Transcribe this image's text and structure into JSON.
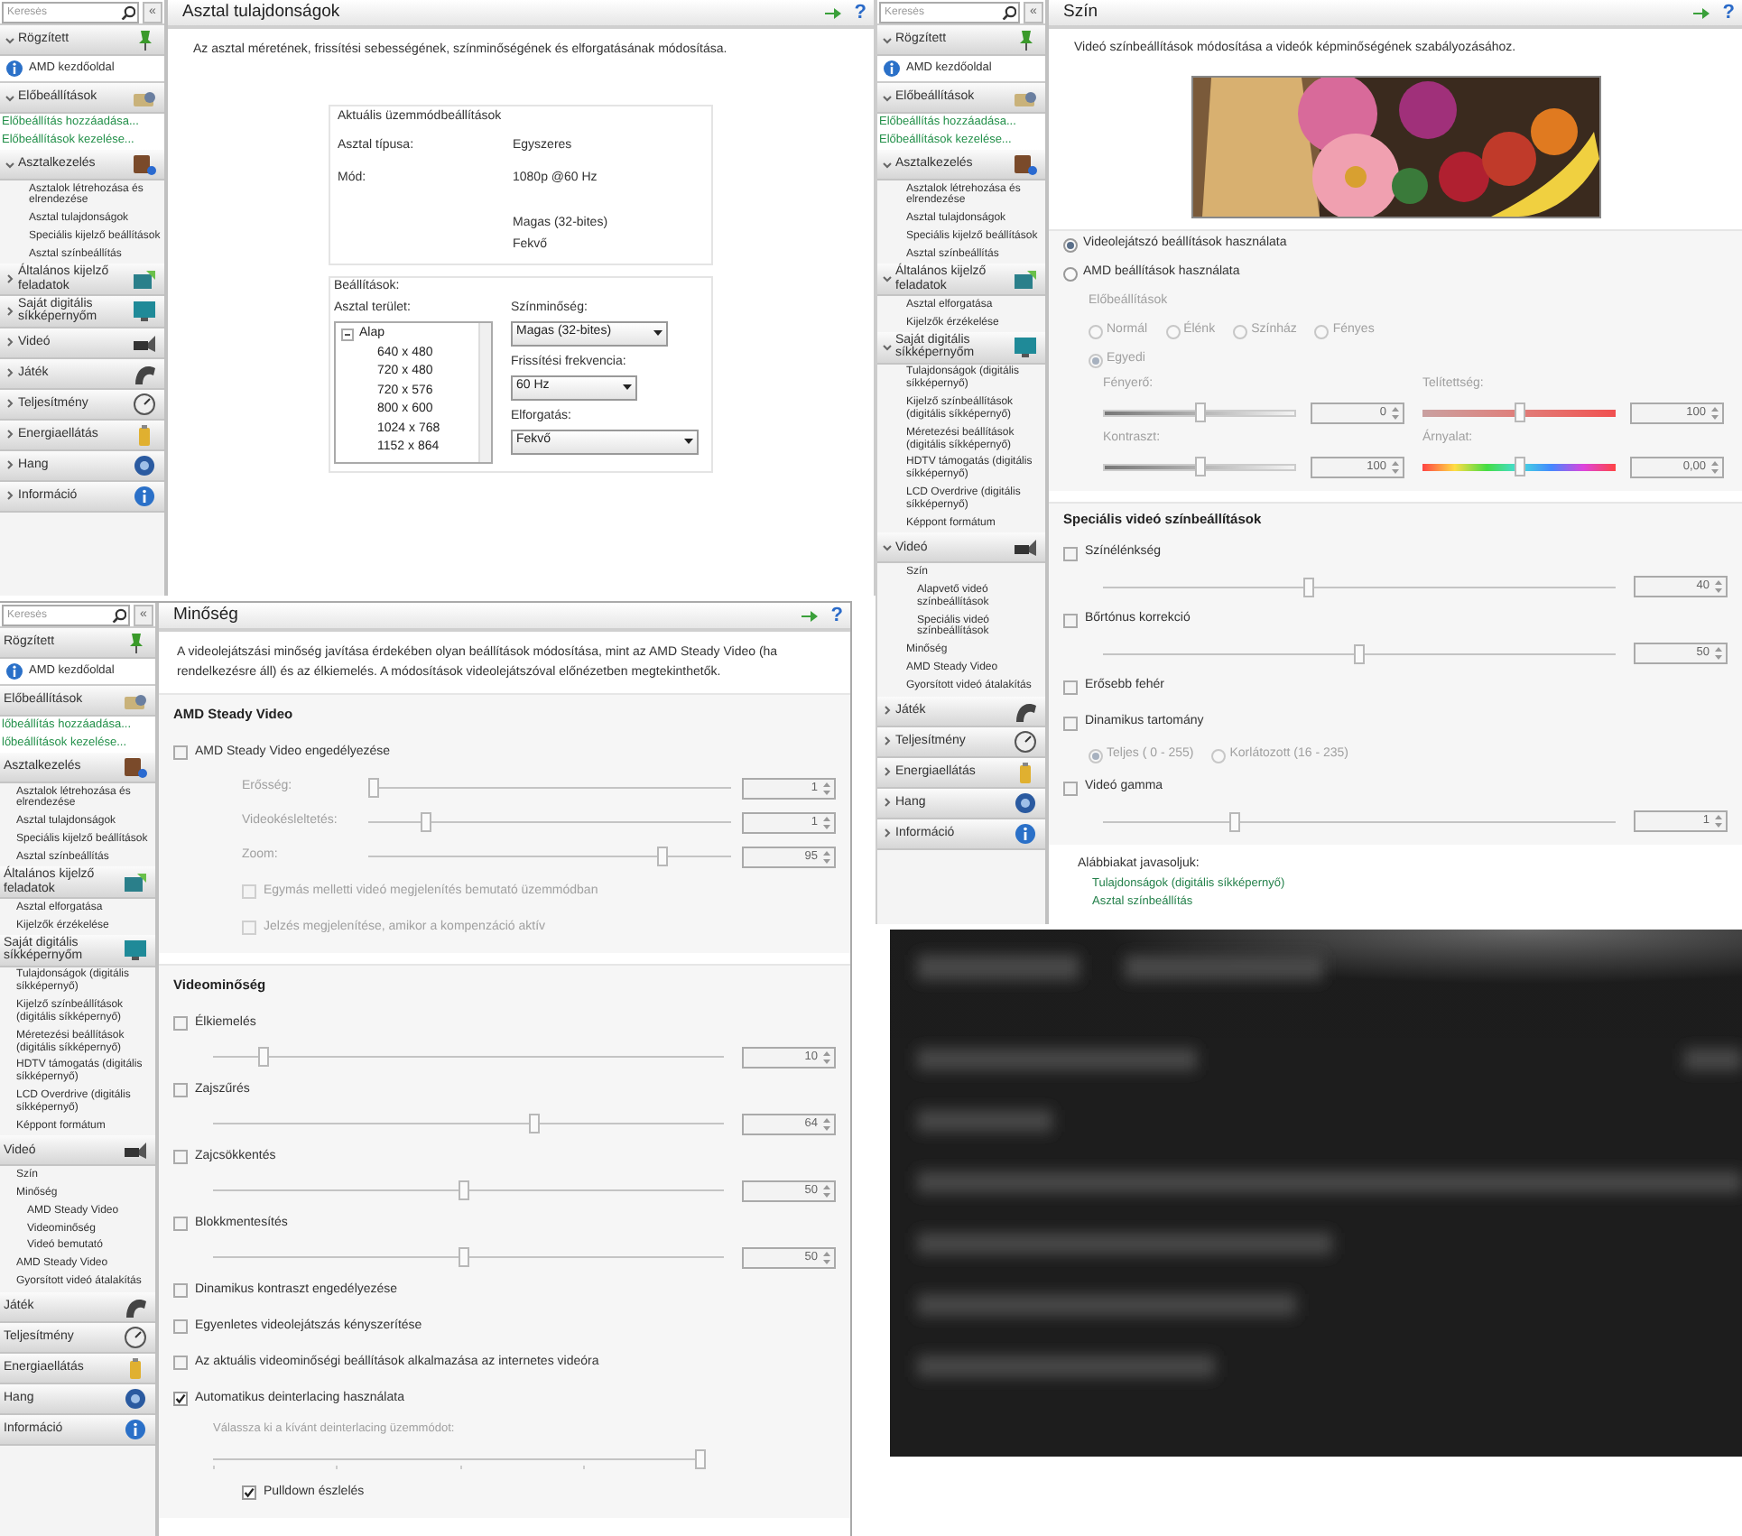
{
  "windows": [
    {
      "kind": "desktop",
      "sidebar": {
        "search_placeholder": "Keresés",
        "collapse": "«",
        "items": [
          {
            "kind": "header",
            "label": "Rögzített",
            "expanded": true
          },
          {
            "kind": "home",
            "label": "AMD kezdőoldal"
          },
          {
            "kind": "header",
            "label": "Előbeállítások",
            "expanded": true
          },
          {
            "kind": "link",
            "label": "Előbeállítás hozzáadása..."
          },
          {
            "kind": "link",
            "label": "Előbeállítások kezelése..."
          },
          {
            "kind": "header",
            "label": "Asztalkezelés",
            "expanded": true
          },
          {
            "kind": "sub",
            "label": "Asztalok létrehozása és elrendezése"
          },
          {
            "kind": "sub",
            "label": "Asztal tulajdonságok"
          },
          {
            "kind": "sub",
            "label": "Speciális kijelző beállítások"
          },
          {
            "kind": "sub",
            "label": "Asztal színbeállítás"
          },
          {
            "kind": "header",
            "label": "Általános kijelző feladatok",
            "expanded": false
          },
          {
            "kind": "header",
            "label": "Saját digitális síkképernyőm",
            "expanded": false
          },
          {
            "kind": "header",
            "label": "Videó",
            "expanded": false
          },
          {
            "kind": "header",
            "label": "Játék",
            "expanded": false
          },
          {
            "kind": "header",
            "label": "Teljesítmény",
            "expanded": false
          },
          {
            "kind": "header",
            "label": "Energiaellátás",
            "expanded": false
          },
          {
            "kind": "header",
            "label": "Hang",
            "expanded": false
          },
          {
            "kind": "header",
            "label": "Információ",
            "expanded": false
          }
        ]
      },
      "title": "Asztal tulajdonságok",
      "help": "?",
      "description": "Az asztal méretének, frissítési sebességének, színminőségének és elforgatásának módosítása.",
      "current_mode": {
        "title": "Aktuális üzemmódbeállítások",
        "rows": [
          {
            "label": "Asztal típusa:",
            "value": "Egyszeres"
          },
          {
            "label": "Mód:",
            "value": "1080p @60 Hz"
          },
          {
            "value": "Magas (32-bites)"
          },
          {
            "value": "Fekvő"
          }
        ]
      },
      "settings": {
        "title": "Beállítások:",
        "area_label": "Asztal terület:",
        "tree": {
          "label": "Alap",
          "expanded": true,
          "items": [
            "640 x 480",
            "720 x 480",
            "720 x 576",
            "800 x 600",
            "1024 x 768",
            "1152 x 864"
          ]
        },
        "fields": [
          {
            "label": "Színminőség:",
            "value": "Magas (32-bites)"
          },
          {
            "label": "Frissítési frekvencia:",
            "value": "60 Hz"
          },
          {
            "label": "Elforgatás:",
            "value": "Fekvő"
          }
        ]
      }
    },
    {
      "kind": "color",
      "sidebar": {
        "search_placeholder": "Keresés",
        "collapse": "«",
        "items": [
          {
            "kind": "header",
            "label": "Rögzített",
            "expanded": true
          },
          {
            "kind": "home",
            "label": "AMD kezdőoldal"
          },
          {
            "kind": "header",
            "label": "Előbeállítások",
            "expanded": true
          },
          {
            "kind": "link",
            "label": "Előbeállítás hozzáadása..."
          },
          {
            "kind": "link",
            "label": "Előbeállítások kezelése..."
          },
          {
            "kind": "header",
            "label": "Asztalkezelés",
            "expanded": true
          },
          {
            "kind": "sub",
            "label": "Asztalok létrehozása és elrendezése"
          },
          {
            "kind": "sub",
            "label": "Asztal tulajdonságok"
          },
          {
            "kind": "sub",
            "label": "Speciális kijelző beállítások"
          },
          {
            "kind": "sub",
            "label": "Asztal színbeállítás"
          },
          {
            "kind": "header",
            "label": "Általános kijelző feladatok",
            "expanded": true
          },
          {
            "kind": "sub",
            "label": "Asztal elforgatása"
          },
          {
            "kind": "sub",
            "label": "Kijelzők érzékelése"
          },
          {
            "kind": "header",
            "label": "Saját digitális síkképernyőm",
            "expanded": true
          },
          {
            "kind": "sub",
            "label": "Tulajdonságok (digitális síkképernyő)"
          },
          {
            "kind": "sub",
            "label": "Kijelző színbeállítások (digitális síkképernyő)"
          },
          {
            "kind": "sub",
            "label": "Méretezési beállítások (digitális síkképernyő)"
          },
          {
            "kind": "sub",
            "label": "HDTV támogatás (digitális síkképernyő)"
          },
          {
            "kind": "sub",
            "label": "LCD Overdrive (digitális síkképernyő)"
          },
          {
            "kind": "sub",
            "label": "Képpont formátum"
          },
          {
            "kind": "header",
            "label": "Videó",
            "expanded": true
          },
          {
            "kind": "sub",
            "label": "Szín"
          },
          {
            "kind": "sub2",
            "label": "Alapvető videó színbeállítások"
          },
          {
            "kind": "sub2",
            "label": "Speciális videó színbeállítások"
          },
          {
            "kind": "sub",
            "label": "Minőség"
          },
          {
            "kind": "sub",
            "label": "AMD Steady Video"
          },
          {
            "kind": "sub",
            "label": "Gyorsított videó átalakítás"
          },
          {
            "kind": "header",
            "label": "Játék",
            "expanded": false
          },
          {
            "kind": "header",
            "label": "Teljesítmény",
            "expanded": false
          },
          {
            "kind": "header",
            "label": "Energiaellátás",
            "expanded": false
          },
          {
            "kind": "header",
            "label": "Hang",
            "expanded": false
          },
          {
            "kind": "header",
            "label": "Információ",
            "expanded": false
          }
        ]
      },
      "title": "Szín",
      "help": "?",
      "description": "Videó színbeállítások módosítása a videók képminőségének szabályozásához.",
      "image": {
        "kind": "picture"
      },
      "sections": [
        {
          "rows": [
            {
              "kind": "radio",
              "label": "Videolejátszó beállítások használata",
              "selected": true,
              "disabled": false
            },
            {
              "kind": "radio",
              "label": "AMD beállítások használata",
              "selected": false,
              "disabled": false
            },
            {
              "kind": "label",
              "text": "Előbeállítások",
              "disabled": true
            },
            {
              "kind": "radio_inline",
              "disabled": true,
              "options": [
                {
                  "label": "Normál",
                  "selected": false
                },
                {
                  "label": "Élénk",
                  "selected": false
                },
                {
                  "label": "Színház",
                  "selected": false
                },
                {
                  "label": "Fényes",
                  "selected": false
                }
              ]
            },
            {
              "kind": "radio_inline",
              "disabled": true,
              "options": [
                {
                  "label": "Egyedi",
                  "selected": true
                }
              ]
            },
            {
              "kind": "slider_pair",
              "items": [
                {
                  "label": "Fényerő:",
                  "value": "0",
                  "level": 0.5,
                  "kind": "gray",
                  "disabled": true
                },
                {
                  "label": "Telítettség:",
                  "value": "100",
                  "level": 0.5,
                  "kind": "red",
                  "disabled": true
                }
              ]
            },
            {
              "kind": "slider_pair",
              "items": [
                {
                  "label": "Kontraszt:",
                  "value": "100",
                  "level": 0.5,
                  "kind": "gray",
                  "disabled": true
                },
                {
                  "label": "Árnyalat:",
                  "value": "0,00",
                  "level": 0.5,
                  "kind": "rainbow",
                  "disabled": true
                }
              ]
            }
          ]
        },
        {
          "heading": "Speciális videó színbeállítások",
          "rows": [
            {
              "kind": "checkbox",
              "label": "Színélénkség",
              "checked": false,
              "disabled": false
            },
            {
              "kind": "slider",
              "value": "40",
              "level": 0.4,
              "disabled": true
            },
            {
              "kind": "checkbox",
              "label": "Bőrtónus korrekció",
              "checked": false,
              "disabled": false
            },
            {
              "kind": "slider",
              "value": "50",
              "level": 0.5,
              "disabled": true
            },
            {
              "kind": "checkbox",
              "label": "Erősebb fehér",
              "checked": false,
              "disabled": false
            },
            {
              "kind": "checkbox",
              "label": "Dinamikus tartomány",
              "checked": false,
              "disabled": false
            },
            {
              "kind": "radio_inline",
              "disabled": true,
              "options": [
                {
                  "label": "Teljes ( 0 - 255)",
                  "selected": true
                },
                {
                  "label": "Korlátozott (16 - 235)",
                  "selected": false
                }
              ]
            },
            {
              "kind": "checkbox",
              "label": "Videó gamma",
              "checked": false,
              "disabled": false
            },
            {
              "kind": "slider",
              "value": "1",
              "level": 0.25,
              "disabled": true
            }
          ]
        }
      ],
      "suggestions": {
        "title": "Alábbiakat javasoljuk:",
        "links": [
          "Tulajdonságok (digitális síkképernyő)",
          "Asztal színbeállítás"
        ]
      }
    },
    {
      "kind": "quality",
      "sidebar": {
        "search_placeholder": "Keresés",
        "collapse": "«",
        "items": [
          {
            "kind": "header",
            "label": "Rögzített"
          },
          {
            "kind": "home",
            "label": "AMD kezdőoldal"
          },
          {
            "kind": "header",
            "label": "Előbeállítások"
          },
          {
            "kind": "link",
            "label": "lőbeállítás hozzáadása..."
          },
          {
            "kind": "link",
            "label": "lőbeállítások kezelése..."
          },
          {
            "kind": "header",
            "label": "Asztalkezelés"
          },
          {
            "kind": "sub",
            "label": "Asztalok létrehozása és elrendezése"
          },
          {
            "kind": "sub",
            "label": "Asztal tulajdonságok"
          },
          {
            "kind": "sub",
            "label": "Speciális kijelző beállítások"
          },
          {
            "kind": "sub",
            "label": "Asztal színbeállítás"
          },
          {
            "kind": "header",
            "label": "Általános kijelző feladatok"
          },
          {
            "kind": "sub",
            "label": "Asztal elforgatása"
          },
          {
            "kind": "sub",
            "label": "Kijelzők érzékelése"
          },
          {
            "kind": "header",
            "label": "Saját digitális síkképernyőm"
          },
          {
            "kind": "sub",
            "label": "Tulajdonságok (digitális síkképernyő)"
          },
          {
            "kind": "sub",
            "label": "Kijelző színbeállítások (digitális síkképernyő)"
          },
          {
            "kind": "sub",
            "label": "Méretezési beállítások (digitális síkképernyő)"
          },
          {
            "kind": "sub",
            "label": "HDTV támogatás (digitális síkképernyő)"
          },
          {
            "kind": "sub",
            "label": "LCD Overdrive (digitális síkképernyő)"
          },
          {
            "kind": "sub",
            "label": "Képpont formátum"
          },
          {
            "kind": "header",
            "label": "Videó"
          },
          {
            "kind": "sub",
            "label": "Szín"
          },
          {
            "kind": "sub",
            "label": "Minőség"
          },
          {
            "kind": "sub2",
            "label": "AMD Steady Video"
          },
          {
            "kind": "sub2",
            "label": "Videominőség"
          },
          {
            "kind": "sub2",
            "label": "Videó bemutató"
          },
          {
            "kind": "sub",
            "label": "AMD Steady Video"
          },
          {
            "kind": "sub",
            "label": "Gyorsított videó átalakítás"
          },
          {
            "kind": "header",
            "label": "Játék"
          },
          {
            "kind": "header",
            "label": "Teljesítmény"
          },
          {
            "kind": "header",
            "label": "Energiaellátás"
          },
          {
            "kind": "header",
            "label": "Hang"
          },
          {
            "kind": "header",
            "label": "Információ"
          }
        ]
      },
      "title": "Minőség",
      "help": "?",
      "description": "A videolejátszási minőség javítása érdekében olyan beállítások módosítása, mint az AMD Steady Video (ha rendelkezésre áll) és az élkiemelés. A módosítások videolejátszóval előnézetben megtekinthetők.",
      "sections": [
        {
          "heading": "AMD Steady Video",
          "rows": [
            {
              "kind": "checkbox",
              "label": "AMD Steady Video engedélyezése",
              "checked": false,
              "disabled": false
            },
            {
              "kind": "slider",
              "label": "Erősség:",
              "value": "1",
              "level": 0.0,
              "disabled": true
            },
            {
              "kind": "slider",
              "label": "Videokésleltetés:",
              "value": "1",
              "level": 0.15,
              "disabled": true
            },
            {
              "kind": "slider",
              "label": "Zoom:",
              "value": "95",
              "level": 0.82,
              "disabled": true
            },
            {
              "kind": "subcheckbox",
              "label": "Egymás melletti videó megjelenítés bemutató üzemmódban",
              "checked": false,
              "disabled": true
            },
            {
              "kind": "subcheckbox",
              "label": "Jelzés megjelenítése, amikor a kompenzáció aktív",
              "checked": false,
              "disabled": true
            }
          ]
        },
        {
          "heading": "Videominőség",
          "rows": [
            {
              "kind": "checkbox",
              "label": "Élkiemelés",
              "checked": false,
              "disabled": false
            },
            {
              "kind": "slider",
              "value": "10",
              "level": 0.09,
              "disabled": true
            },
            {
              "kind": "checkbox",
              "label": "Zajszűrés",
              "checked": false,
              "disabled": false
            },
            {
              "kind": "slider",
              "value": "64",
              "level": 0.63,
              "disabled": true
            },
            {
              "kind": "checkbox",
              "label": "Zajcsökkentés",
              "checked": false,
              "disabled": false
            },
            {
              "kind": "slider",
              "value": "50",
              "level": 0.49,
              "disabled": true
            },
            {
              "kind": "checkbox",
              "label": "Blokkmentesítés",
              "checked": false,
              "disabled": false
            },
            {
              "kind": "slider",
              "value": "50",
              "level": 0.49,
              "disabled": true
            },
            {
              "kind": "checkbox",
              "label": "Dinamikus kontraszt engedélyezése",
              "checked": false,
              "disabled": false
            },
            {
              "kind": "checkbox",
              "label": "Egyenletes videolejátszás kényszerítése",
              "checked": false,
              "disabled": false
            },
            {
              "kind": "checkbox",
              "label": "Az aktuális videominőségi beállítások alkalmazása az internetes videóra",
              "checked": false,
              "disabled": false
            },
            {
              "kind": "checkbox",
              "label": "Automatikus deinterlacing használata",
              "checked": true,
              "disabled": false
            },
            {
              "kind": "subtext",
              "text": "Válassza ki a kívánt deinterlacing üzemmódot:",
              "disabled": true
            },
            {
              "kind": "tick_slider",
              "level": 1.0,
              "disabled": true
            },
            {
              "kind": "subcheckbox",
              "label": "Pulldown észlelés",
              "checked": true,
              "disabled": false
            }
          ]
        }
      ]
    },
    {
      "kind": "blurred",
      "image": {
        "kind": "picture"
      }
    }
  ]
}
